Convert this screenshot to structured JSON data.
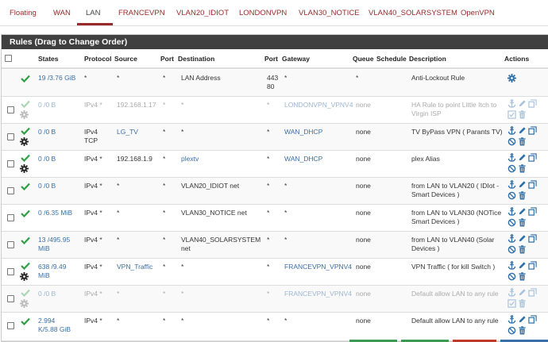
{
  "tabs": [
    {
      "label": "Floating",
      "active": false
    },
    {
      "label": "WAN",
      "active": false
    },
    {
      "label": "LAN",
      "active": true
    },
    {
      "label": "FRANCEVPN",
      "active": false
    },
    {
      "label": "VLAN20_IDIOT",
      "active": false
    },
    {
      "label": "LONDONVPN",
      "active": false
    },
    {
      "label": "VLAN30_NOTICE",
      "active": false
    },
    {
      "label": "VLAN40_SOLARSYSTEM",
      "active": false
    },
    {
      "label": "OpenVPN",
      "active": false
    }
  ],
  "panel": {
    "title": "Rules (Drag to Change Order)"
  },
  "columns": {
    "states": "States",
    "protocol": "Protocol",
    "source": "Source",
    "port": "Port",
    "destination": "Destination",
    "dport": "Port",
    "gateway": "Gateway",
    "queue": "Queue",
    "schedule": "Schedule",
    "description": "Description",
    "actions": "Actions"
  },
  "rules": [
    {
      "disabled": false,
      "checkbox": false,
      "gear": false,
      "actions": "gear-only",
      "states": [
        "19 /3.76 GiB"
      ],
      "protocol": [
        "*"
      ],
      "source": "*",
      "source_link": false,
      "port": "*",
      "destination": [
        "LAN Address"
      ],
      "dest_link": false,
      "dport": [
        "443",
        "80"
      ],
      "gateway": "*",
      "gateway_link": false,
      "queue": "*",
      "schedule": "",
      "description": [
        "Anti-Lockout Rule"
      ]
    },
    {
      "disabled": true,
      "checkbox": true,
      "gear": true,
      "actions": "full",
      "states": [
        "0 /0 B"
      ],
      "protocol": [
        "IPv4 *"
      ],
      "source": "192.168.1.17",
      "source_link": false,
      "port": "*",
      "destination": [
        "*"
      ],
      "dest_link": false,
      "dport": [
        "*"
      ],
      "gateway": "LONDONVPN_VPNV4",
      "gateway_link": true,
      "queue": "none",
      "schedule": "",
      "description": [
        "HA Rule to point Little Itch to",
        "Virgin ISP"
      ]
    },
    {
      "disabled": false,
      "checkbox": true,
      "gear": true,
      "actions": "full",
      "states": [
        "0 /0 B"
      ],
      "protocol": [
        "IPv4",
        "TCP"
      ],
      "source": "LG_TV",
      "source_link": true,
      "port": "*",
      "destination": [
        "*"
      ],
      "dest_link": false,
      "dport": [
        "*"
      ],
      "gateway": "WAN_DHCP",
      "gateway_link": true,
      "queue": "none",
      "schedule": "",
      "description": [
        "TV ByPass VPN ( Parants TV)"
      ]
    },
    {
      "disabled": false,
      "checkbox": true,
      "gear": true,
      "actions": "full",
      "states": [
        "0 /0 B"
      ],
      "protocol": [
        "IPv4 *"
      ],
      "source": "192.168.1.9",
      "source_link": false,
      "port": "*",
      "destination": [
        "plextv"
      ],
      "dest_link": true,
      "dport": [
        "*"
      ],
      "gateway": "WAN_DHCP",
      "gateway_link": true,
      "queue": "none",
      "schedule": "",
      "description": [
        "plex Alias"
      ]
    },
    {
      "disabled": false,
      "checkbox": true,
      "gear": false,
      "actions": "full",
      "states": [
        "0 /0 B"
      ],
      "protocol": [
        "IPv4 *"
      ],
      "source": "*",
      "source_link": false,
      "port": "*",
      "destination": [
        "VLAN20_IDIOT net"
      ],
      "dest_link": false,
      "dport": [
        "*"
      ],
      "gateway": "*",
      "gateway_link": false,
      "queue": "none",
      "schedule": "",
      "description": [
        "from LAN to VLAN20 ( IDIot -",
        "Smart Devices )"
      ]
    },
    {
      "disabled": false,
      "checkbox": true,
      "gear": false,
      "actions": "full",
      "states": [
        "0 /6.35 MiB"
      ],
      "protocol": [
        "IPv4 *"
      ],
      "source": "*",
      "source_link": false,
      "port": "*",
      "destination": [
        "VLAN30_NOTICE net"
      ],
      "dest_link": false,
      "dport": [
        "*"
      ],
      "gateway": "*",
      "gateway_link": false,
      "queue": "none",
      "schedule": "",
      "description": [
        "from LAN to VLAN30 (NOTice",
        "Smart Devices )"
      ]
    },
    {
      "disabled": false,
      "checkbox": true,
      "gear": false,
      "actions": "full",
      "states": [
        "13 /495.95",
        "MiB"
      ],
      "protocol": [
        "IPv4 *"
      ],
      "source": "*",
      "source_link": false,
      "port": "*",
      "destination": [
        "VLAN40_SOLARSYSTEM",
        "net"
      ],
      "dest_link": false,
      "dport": [
        "*"
      ],
      "gateway": "*",
      "gateway_link": false,
      "queue": "none",
      "schedule": "",
      "description": [
        "from LAN to VLAN40 (Solar",
        "Devices )"
      ]
    },
    {
      "disabled": false,
      "checkbox": true,
      "gear": true,
      "actions": "full",
      "states": [
        "638 /9.49",
        "MiB"
      ],
      "protocol": [
        "IPv4 *"
      ],
      "source": "VPN_Traffic",
      "source_link": true,
      "port": "*",
      "destination": [
        "*"
      ],
      "dest_link": false,
      "dport": [
        "*"
      ],
      "gateway": "FRANCEVPN_VPNV4",
      "gateway_link": true,
      "queue": "none",
      "schedule": "",
      "description": [
        "VPN Traffic ( for kill Switch )"
      ]
    },
    {
      "disabled": true,
      "checkbox": true,
      "gear": true,
      "actions": "full",
      "states": [
        "0 /0 B"
      ],
      "protocol": [
        "IPv4 *"
      ],
      "source": "*",
      "source_link": false,
      "port": "*",
      "destination": [
        "*"
      ],
      "dest_link": false,
      "dport": [
        "*"
      ],
      "gateway": "FRANCEVPN_VPNV4",
      "gateway_link": true,
      "queue": "none",
      "schedule": "",
      "description": [
        "Default allow LAN to any rule"
      ]
    },
    {
      "disabled": false,
      "checkbox": true,
      "gear": false,
      "actions": "full",
      "states": [
        "2.994",
        "K/5.88 GiB"
      ],
      "protocol": [
        "IPv4 *"
      ],
      "source": "*",
      "source_link": false,
      "port": "*",
      "destination": [
        "*"
      ],
      "dest_link": false,
      "dport": [
        "*"
      ],
      "gateway": "*",
      "gateway_link": false,
      "queue": "none",
      "schedule": "",
      "description": [
        "Default allow LAN to any rule"
      ]
    }
  ],
  "colors": {
    "accent": "#9a2a2a",
    "link": "#3a6fa5",
    "pass": "#2f9e44",
    "icon": "#2f6fa7",
    "delete": "#2f6fa7",
    "header": "#404040"
  },
  "icons": {
    "pass": "check-icon",
    "gear": "gear-icon",
    "anchor": "anchor-icon",
    "edit": "pencil-icon",
    "copy": "copy-icon",
    "disable": "ban-icon",
    "delete": "trash-icon"
  }
}
